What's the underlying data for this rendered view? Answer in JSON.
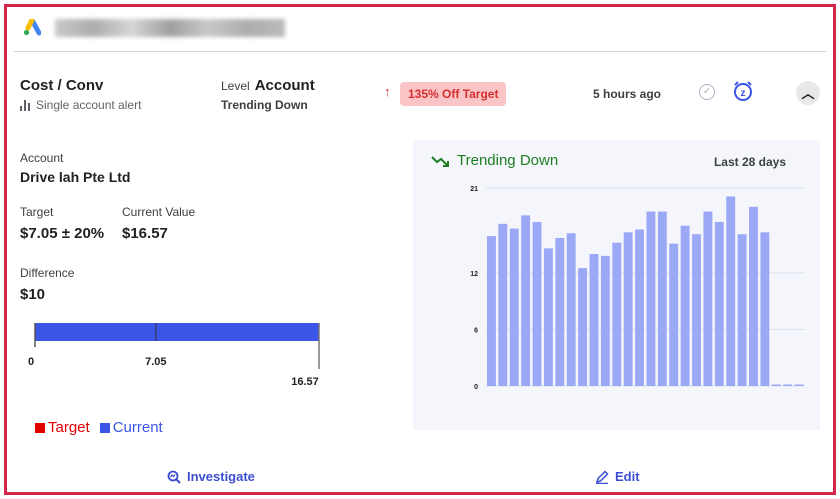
{
  "header": {
    "logo": "google-ads-logo"
  },
  "alert": {
    "metric": "Cost / Conv",
    "subtitle": "Single account alert",
    "level_label": "Level",
    "level_value": "Account",
    "trend": "Trending Down",
    "badge": "135% Off Target",
    "time": "5 hours ago"
  },
  "details": {
    "account_label": "Account",
    "account_value": "Drive lah Pte Ltd",
    "target_label": "Target",
    "target_value": "$7.05 ± 20%",
    "current_label": "Current Value",
    "current_value": "$16.57",
    "difference_label": "Difference",
    "difference_value": "$10"
  },
  "chart_data": [
    {
      "type": "bar",
      "orientation": "horizontal",
      "min": 0,
      "target": 7.05,
      "current": 16.57,
      "tick_labels": [
        "0",
        "7.05",
        "16.57"
      ],
      "legend": [
        {
          "name": "Target",
          "color": "#e00000"
        },
        {
          "name": "Current",
          "color": "#3b55e6"
        }
      ]
    },
    {
      "type": "bar",
      "title": "Trending Down",
      "subtitle": "Last 28 days",
      "ylim": [
        0,
        21
      ],
      "yticks": [
        "0",
        "6",
        "12",
        "21"
      ],
      "values": [
        15.9,
        17.2,
        16.7,
        18.1,
        17.4,
        14.6,
        15.7,
        16.2,
        12.5,
        14.0,
        13.8,
        15.2,
        16.3,
        16.6,
        18.5,
        18.5,
        15.1,
        17.0,
        16.1,
        18.5,
        17.4,
        20.1,
        16.1,
        19.0,
        16.3,
        0,
        0,
        0
      ],
      "color": "#9aa8f5"
    }
  ],
  "actions": {
    "investigate": "Investigate",
    "edit": "Edit"
  }
}
